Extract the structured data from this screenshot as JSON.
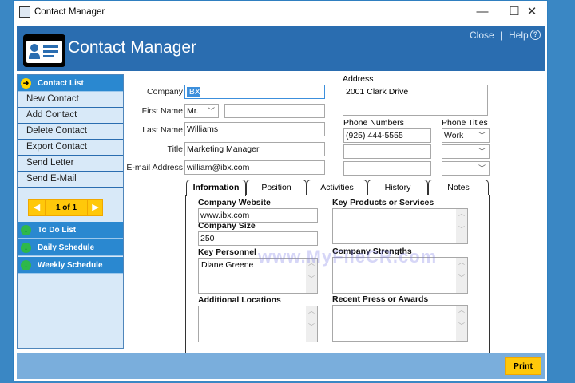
{
  "window": {
    "title": "Contact Manager",
    "controls": {
      "minimize": "—",
      "maximize": "☐",
      "close": "✕"
    }
  },
  "header": {
    "title": "Contact Manager",
    "close_link": "Close",
    "separator": "|",
    "help_link": "Help",
    "help_icon": "?"
  },
  "sidebar": {
    "contact_list": "Contact List",
    "items": [
      "New Contact",
      "Add Contact",
      "Delete Contact",
      "Export Contact",
      "Send Letter",
      "Send E-Mail"
    ],
    "pager": "1 of 1",
    "sections": [
      "To Do List",
      "Daily Schedule",
      "Weekly Schedule"
    ]
  },
  "form": {
    "company_label": "Company",
    "company": "IBX",
    "first_name_label": "First Name",
    "salutation": "Mr.",
    "first_name": "",
    "last_name_label": "Last Name",
    "last_name": "Williams",
    "title_label": "Title",
    "title": "Marketing Manager",
    "email_label": "E-mail Address",
    "email": "william@ibx.com",
    "address_label": "Address",
    "address": "2001 Clark Drive",
    "phone_numbers_label": "Phone Numbers",
    "phones": [
      "(925) 444-5555",
      "",
      ""
    ],
    "phone_titles_label": "Phone Titles",
    "phone_titles": [
      "Work",
      "",
      ""
    ]
  },
  "tabs": [
    "Information",
    "Position",
    "Activities",
    "History",
    "Notes"
  ],
  "info": {
    "website_label": "Company Website",
    "website": "www.ibx.com",
    "size_label": "Company Size",
    "size": "250",
    "personnel_label": "Key Personnel",
    "personnel": "Diane Greene",
    "locations_label": "Additional Locations",
    "products_label": "Key Products or Services",
    "strengths_label": "Company Strengths",
    "press_label": "Recent Press or Awards"
  },
  "watermark": "www.MyFileCR.com",
  "footer": {
    "print": "Print"
  },
  "colors": {
    "header": "#2a6db0",
    "sidebar_head": "#2a88d0",
    "accent": "#ffc80a",
    "footer": "#7aaedc"
  }
}
